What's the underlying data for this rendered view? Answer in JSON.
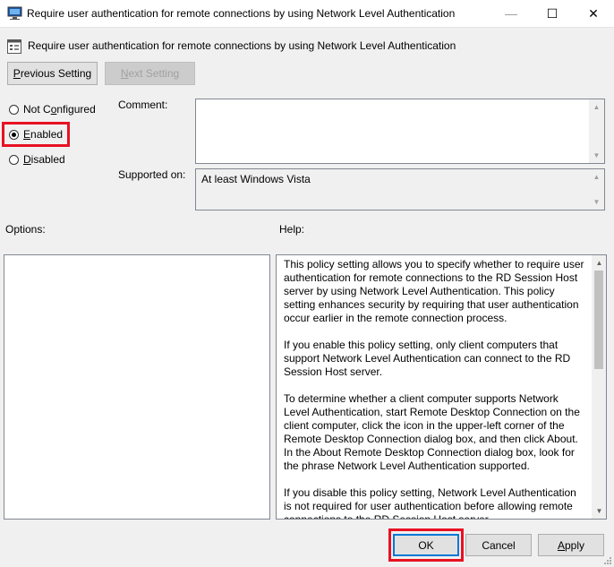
{
  "window": {
    "title": "Require user authentication for remote connections by using Network Level Authentication",
    "minimize_glyph": "—",
    "maximize_glyph": "☐",
    "close_glyph": "✕"
  },
  "header": {
    "policy_title": "Require user authentication for remote connections by using Network Level Authentication",
    "icon": "policy-setting-icon"
  },
  "nav": {
    "previous_label_accel": "P",
    "previous_label_rest": "revious Setting",
    "next_label_accel": "N",
    "next_label_rest": "ext Setting"
  },
  "state": {
    "options": [
      {
        "accel": "",
        "pre": "Not C",
        "accel2": "o",
        "post": "nfigured",
        "checked": false
      },
      {
        "pre": "",
        "accel": "E",
        "post": "nabled",
        "checked": true
      },
      {
        "pre": "",
        "accel": "D",
        "post": "isabled",
        "checked": false
      }
    ]
  },
  "labels": {
    "comment": "Comment:",
    "supported_on": "Supported on:",
    "options": "Options:",
    "help": "Help:"
  },
  "comment_value": "",
  "supported_on_value": "At least Windows Vista",
  "help_paragraphs": [
    "This policy setting allows you to specify whether to require user authentication for remote connections to the RD Session Host server by using Network Level Authentication. This policy setting enhances security by requiring that user authentication occur earlier in the remote connection process.",
    "If you enable this policy setting, only client computers that support Network Level Authentication can connect to the RD Session Host server.",
    "To determine whether a client computer supports Network Level Authentication, start Remote Desktop Connection on the client computer, click the icon in the upper-left corner of the Remote Desktop Connection dialog box, and then click About. In the About Remote Desktop Connection dialog box, look for the phrase Network Level Authentication supported.",
    "If you disable this policy setting, Network Level Authentication is not required for user authentication before allowing remote connections to the RD Session Host server."
  ],
  "footer": {
    "ok_label": "OK",
    "cancel_label": "Cancel",
    "apply_pre": "",
    "apply_accel": "A",
    "apply_post": "pply"
  },
  "colors": {
    "highlight": "#e81123",
    "default_button_border": "#0078d7"
  }
}
